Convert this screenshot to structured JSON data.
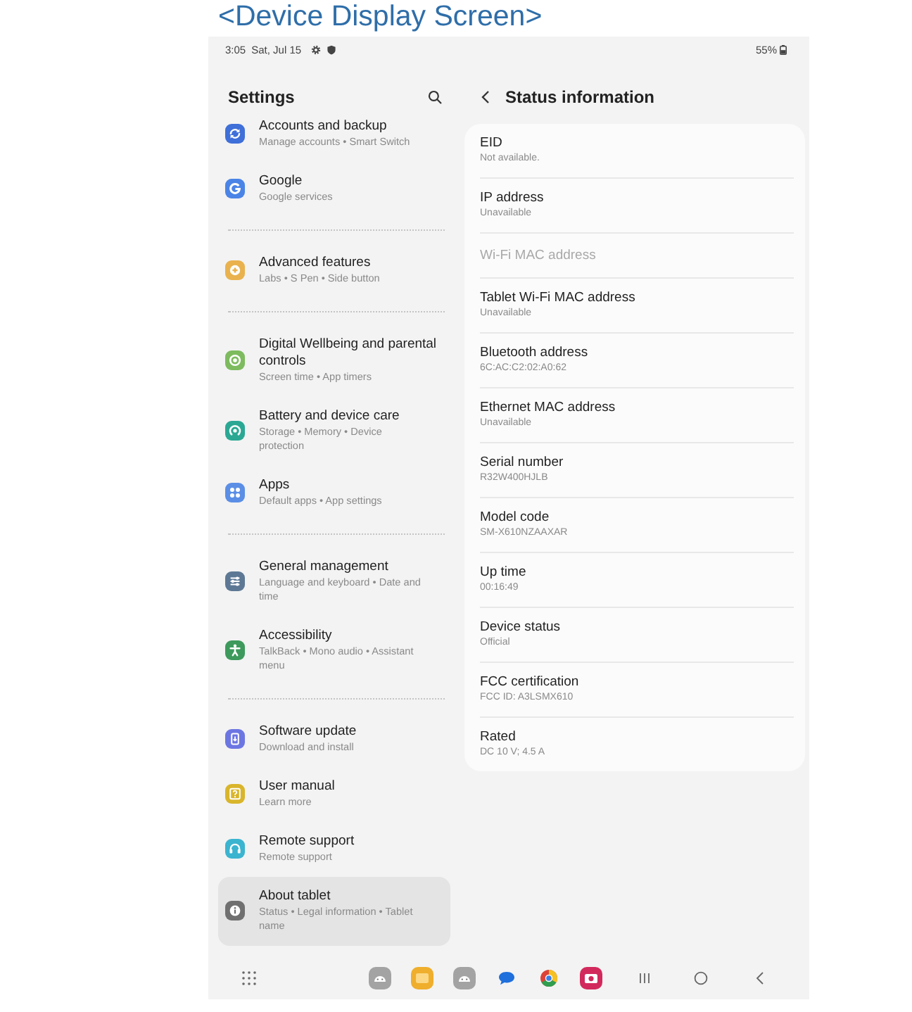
{
  "heading": "<Device Display Screen>",
  "status_bar": {
    "time": "3:05",
    "date": "Sat, Jul 15",
    "battery": "55%"
  },
  "settings_panel": {
    "title": "Settings",
    "groups": [
      {
        "items": [
          {
            "title": "Accounts and backup",
            "subtitle": "Manage accounts • Smart Switch",
            "color": "#3f6fd8",
            "selected": false
          },
          {
            "title": "Google",
            "subtitle": "Google services",
            "color": "#4a84e6",
            "selected": false
          }
        ]
      },
      {
        "items": [
          {
            "title": "Advanced features",
            "subtitle": "Labs • S Pen • Side button",
            "color": "#e9b24e",
            "selected": false
          }
        ]
      },
      {
        "items": [
          {
            "title": "Digital Wellbeing and parental controls",
            "subtitle": "Screen time • App timers",
            "color": "#7dbb5e",
            "selected": false
          },
          {
            "title": "Battery and device care",
            "subtitle": "Storage • Memory • Device protection",
            "color": "#2aa894",
            "selected": false
          },
          {
            "title": "Apps",
            "subtitle": "Default apps • App settings",
            "color": "#5b8fe6",
            "selected": false
          }
        ]
      },
      {
        "items": [
          {
            "title": "General management",
            "subtitle": "Language and keyboard • Date and time",
            "color": "#5d7894",
            "selected": false
          },
          {
            "title": "Accessibility",
            "subtitle": "TalkBack • Mono audio • Assistant menu",
            "color": "#3d9a5c",
            "selected": false
          }
        ]
      },
      {
        "items": [
          {
            "title": "Software update",
            "subtitle": "Download and install",
            "color": "#6c76e2",
            "selected": false
          },
          {
            "title": "User manual",
            "subtitle": "Learn more",
            "color": "#d9b52b",
            "selected": false
          },
          {
            "title": "Remote support",
            "subtitle": "Remote support",
            "color": "#3bb4d0",
            "selected": false
          },
          {
            "title": "About tablet",
            "subtitle": "Status • Legal information • Tablet name",
            "color": "#707070",
            "selected": true
          }
        ]
      }
    ]
  },
  "detail_panel": {
    "title": "Status information",
    "rows": [
      {
        "label": "EID",
        "value": "Not available.",
        "disabled": false
      },
      {
        "label": "IP address",
        "value": "Unavailable",
        "disabled": false
      },
      {
        "label": "Wi-Fi MAC address",
        "disabled": true
      },
      {
        "label": "Tablet Wi-Fi MAC address",
        "value": "Unavailable",
        "disabled": false
      },
      {
        "label": "Bluetooth address",
        "value": "6C:AC:C2:02:A0:62",
        "disabled": false
      },
      {
        "label": "Ethernet MAC address",
        "value": "Unavailable",
        "disabled": false
      },
      {
        "label": "Serial number",
        "value": "R32W400HJLB",
        "disabled": false
      },
      {
        "label": "Model code",
        "value": "SM-X610NZAAXAR",
        "disabled": false
      },
      {
        "label": "Up time",
        "value": "00:16:49",
        "disabled": false
      },
      {
        "label": "Device status",
        "value": "Official",
        "disabled": false
      },
      {
        "label": "FCC certification",
        "value": "FCC ID: A3LSMX610",
        "disabled": false
      },
      {
        "label": "Rated",
        "value": "DC 10 V; 4.5 A",
        "disabled": false
      }
    ]
  }
}
